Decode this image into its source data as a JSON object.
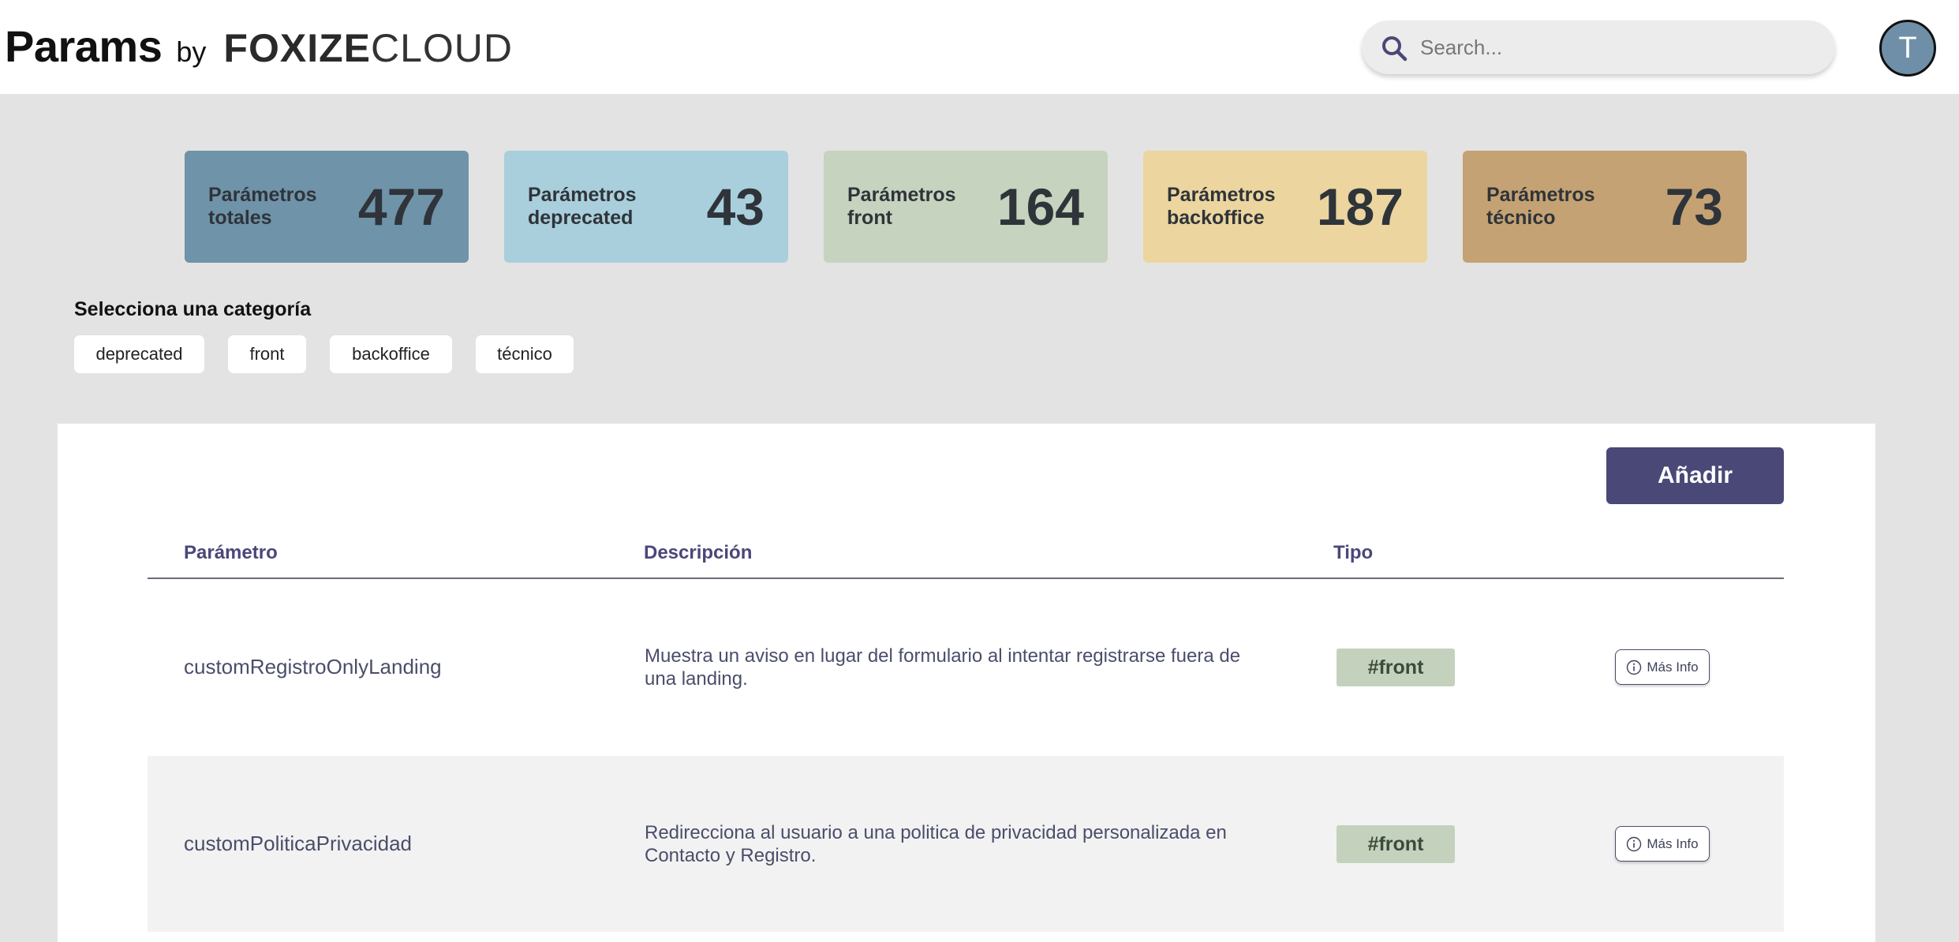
{
  "header": {
    "title": "Params",
    "by": "by",
    "logo_strong": "FOXIZE",
    "logo_light": "CLOUD",
    "search_placeholder": "Search...",
    "avatar_initial": "T"
  },
  "stats": [
    {
      "label": "Parámetros totales",
      "value": "477",
      "color": "#6f93a9"
    },
    {
      "label": "Parámetros deprecated",
      "value": "43",
      "color": "#a9cfdc"
    },
    {
      "label": "Parámetros front",
      "value": "164",
      "color": "#c6d3bf"
    },
    {
      "label": "Parámetros backoffice",
      "value": "187",
      "color": "#ecd59f"
    },
    {
      "label": "Parámetros técnico",
      "value": "73",
      "color": "#c5a273"
    }
  ],
  "categories": {
    "title": "Selecciona una categoría",
    "items": [
      "deprecated",
      "front",
      "backoffice",
      "técnico"
    ]
  },
  "table": {
    "add_label": "Añadir",
    "columns": [
      "Parámetro",
      "Descripción",
      "Tipo"
    ],
    "rows": [
      {
        "param": "customRegistroOnlyLanding",
        "description": "Muestra un aviso en lugar del formulario al intentar registrarse fuera de una landing.",
        "type": "#front",
        "action": "Más Info"
      },
      {
        "param": "customPoliticaPrivacidad",
        "description": "Redirecciona al usuario a una politica de privacidad personalizada en Contacto y Registro.",
        "type": "#front",
        "action": "Más Info"
      }
    ]
  }
}
